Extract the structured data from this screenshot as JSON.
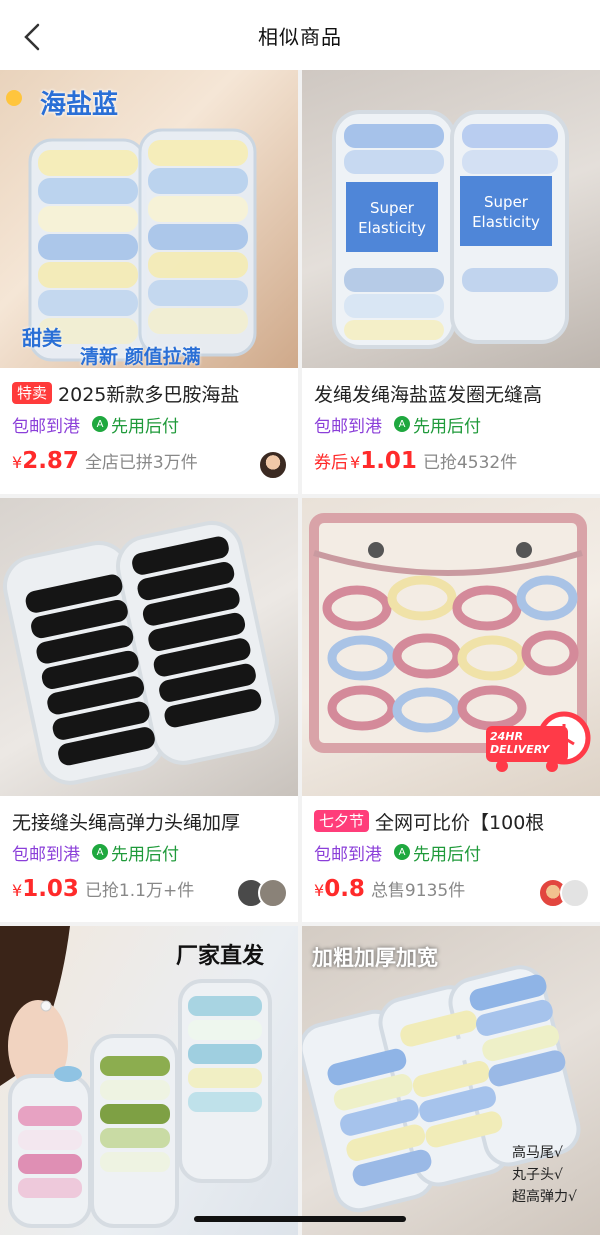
{
  "header": {
    "title": "相似商品",
    "back_icon": "chevron-left-icon"
  },
  "products": [
    {
      "badge": "特卖",
      "title": "2025新款多巴胺海盐",
      "shipping": "包邮到港",
      "pay": "先用后付",
      "coupon": "",
      "price": "2.87",
      "sold": "全店已拼3万件",
      "image_text": [
        "海盐蓝",
        "甜美",
        "清新 颜值拉满"
      ]
    },
    {
      "badge": "",
      "title": "发绳发绳海盐蓝发圈无缝高",
      "shipping": "包邮到港",
      "pay": "先用后付",
      "coupon": "券后",
      "price": "1.01",
      "sold": "已抢4532件",
      "image_text": [
        "Super Elasticity",
        "Super Elasticity"
      ]
    },
    {
      "badge": "",
      "title": "无接缝头绳高弹力头绳加厚",
      "shipping": "包邮到港",
      "pay": "先用后付",
      "coupon": "",
      "price": "1.03",
      "sold": "已抢1.1万+件",
      "image_text": []
    },
    {
      "badge": "七夕节",
      "title": "全网可比价【100根",
      "shipping": "包邮到港",
      "pay": "先用后付",
      "coupon": "",
      "price": "0.8",
      "sold": "总售9135件",
      "image_text": [
        "24HR DELIVERY"
      ]
    },
    {
      "image_text": [
        "厂家直发"
      ]
    },
    {
      "image_text": [
        "加粗加厚加宽",
        "高马尾√",
        "丸子头√",
        "超高弹力√"
      ]
    }
  ],
  "currency": "¥",
  "colors": {
    "price_red": "#ff2a2a",
    "ship_purple": "#8b3fd9",
    "pay_green": "#1f9a3a"
  }
}
